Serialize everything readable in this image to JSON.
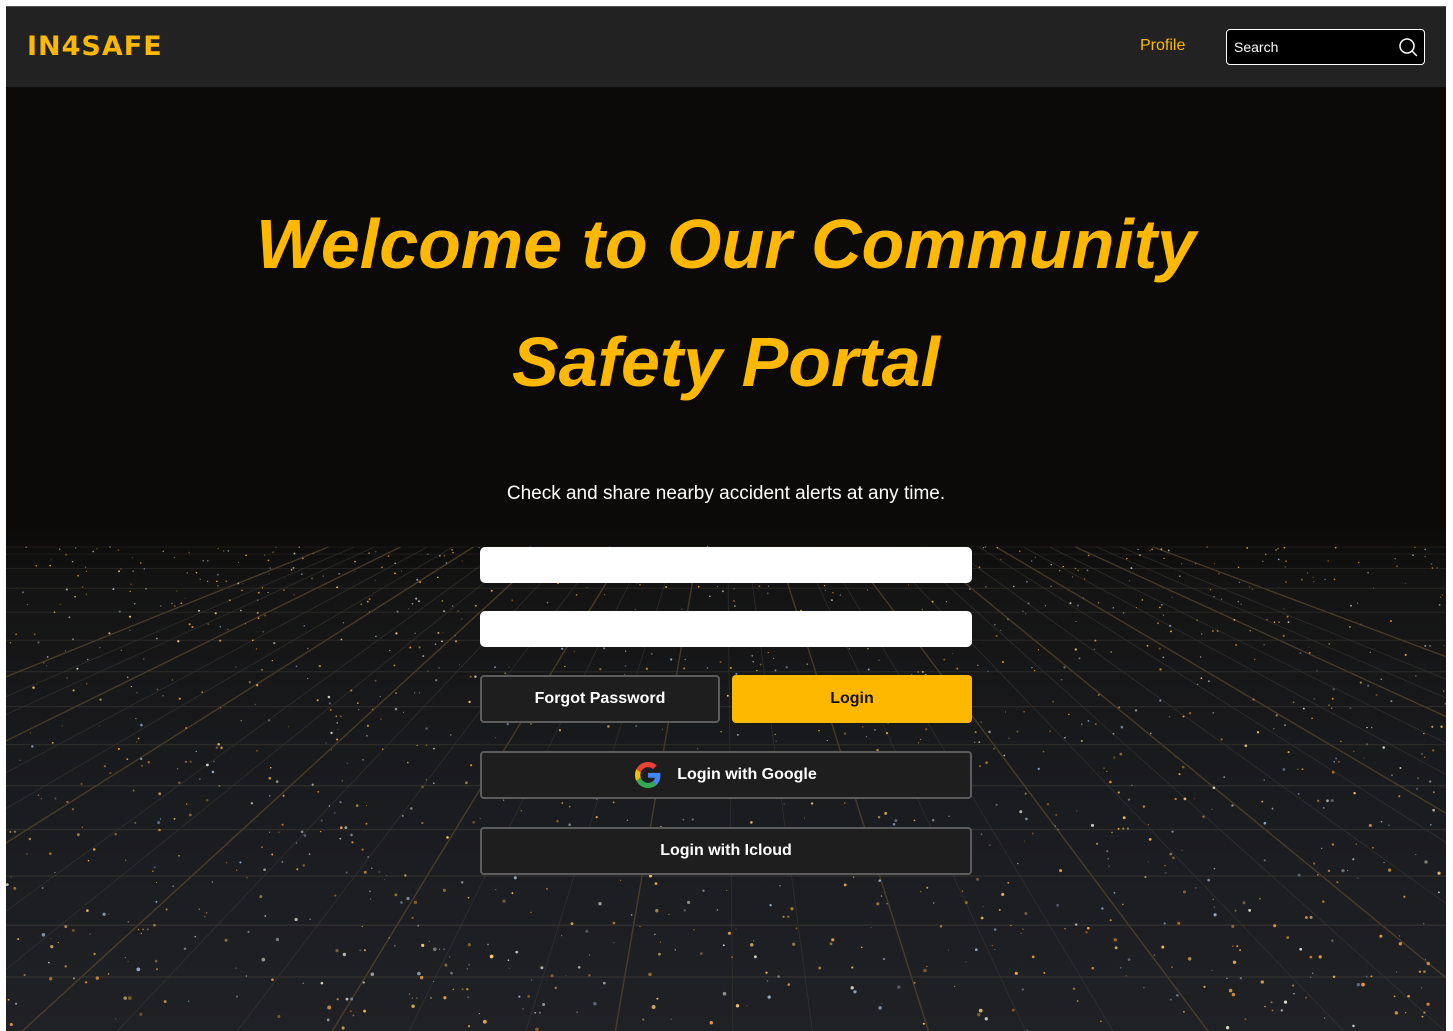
{
  "colors": {
    "accent": "#FFB800",
    "navbar_bg": "#222222",
    "page_bg": "#0b0a09",
    "button_dark_bg": "#1e1e1e"
  },
  "navbar": {
    "logo": "IN4SAFE",
    "profile_link": "Profile",
    "search": {
      "placeholder": "Search",
      "icon": "search-icon"
    }
  },
  "hero": {
    "title_line1": "Welcome to Our Community",
    "title_line2": "Safety Portal",
    "subtitle": "Check and share nearby accident alerts at any time."
  },
  "form": {
    "username_value": "",
    "password_value": "",
    "forgot_password_label": "Forgot Password",
    "login_label": "Login",
    "google_login_label": "Login with Google",
    "google_icon": "google-icon",
    "icloud_login_label": "Login with Icloud"
  }
}
